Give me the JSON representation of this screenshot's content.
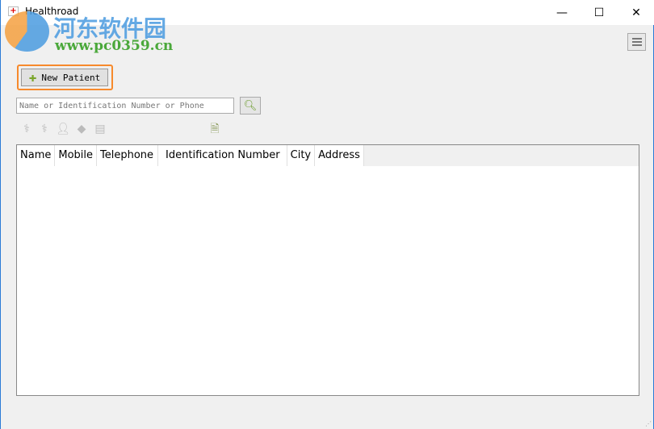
{
  "window": {
    "title": "Healthroad",
    "minimize": "—",
    "maximize": "☐",
    "close": "✕"
  },
  "watermark": {
    "text_cn": "河东软件园",
    "url": "www.pc0359.cn"
  },
  "toolbar": {
    "new_patient_label": "New Patient"
  },
  "search": {
    "placeholder": "Name or Identification Number or Phone",
    "value": ""
  },
  "icons": [
    "stethoscope-icon",
    "stethoscope-icon",
    "user-icon",
    "book-icon",
    "notebook-icon",
    "document-icon"
  ],
  "table": {
    "columns": [
      "Name",
      "Mobile",
      "Telephone",
      "Identification Number",
      "City",
      "Address"
    ],
    "rows": []
  },
  "colors": {
    "focus": "#f78a2c",
    "accent": "#7aa52a"
  }
}
